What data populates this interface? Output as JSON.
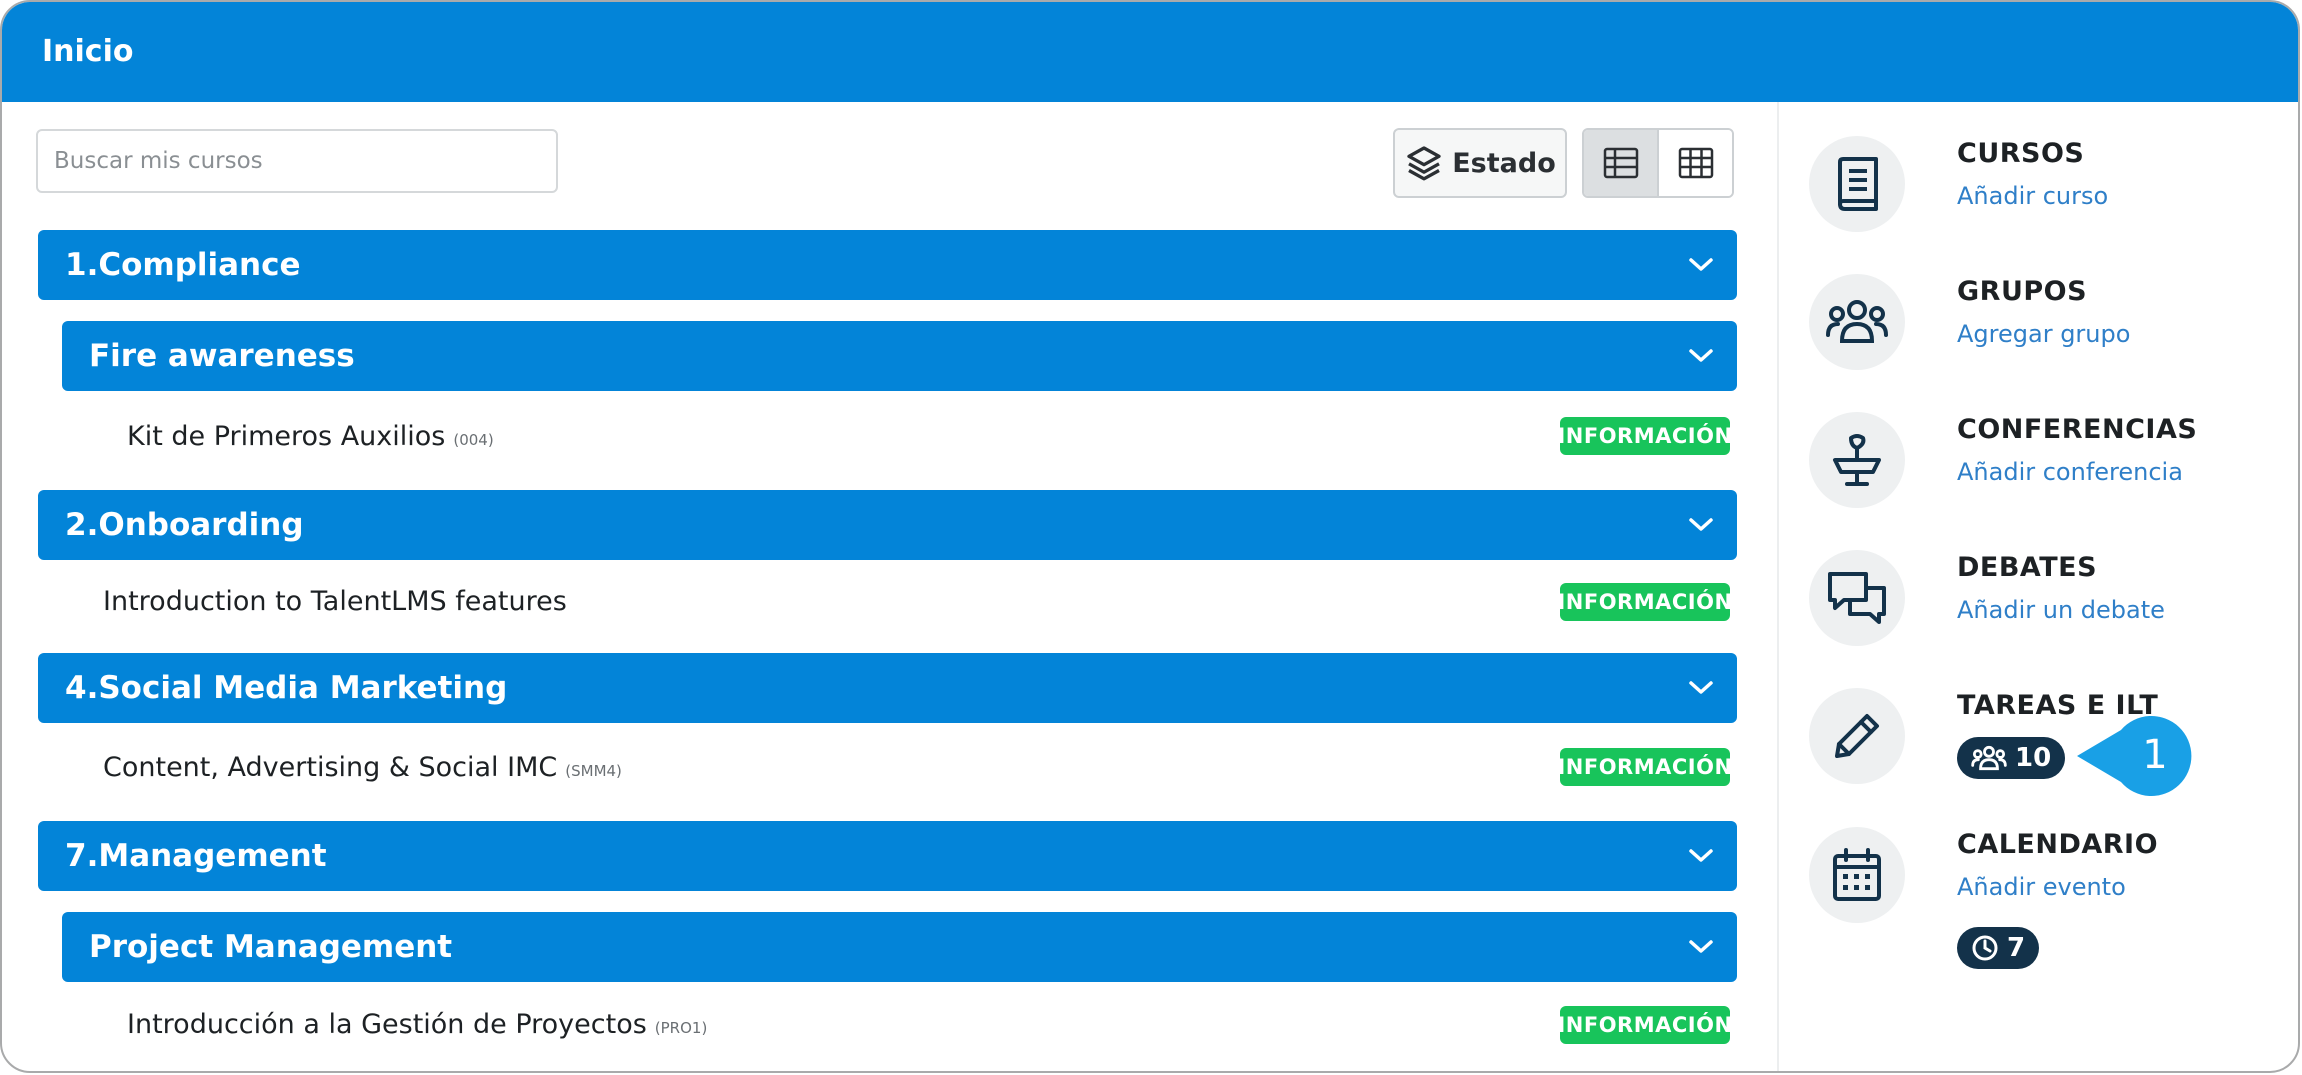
{
  "page": {
    "title": "Inicio"
  },
  "search": {
    "placeholder": "Buscar mis cursos"
  },
  "toolbar": {
    "estado_label": "Estado"
  },
  "categories": [
    {
      "title": "1.Compliance"
    },
    {
      "title": "Fire awareness"
    },
    {
      "title": "2.Onboarding"
    },
    {
      "title": "4.Social Media Marketing"
    },
    {
      "title": "7.Management"
    },
    {
      "title": "Project Management"
    }
  ],
  "courses": [
    {
      "name": "Kit de Primeros Auxilios",
      "code": "(004)",
      "badge": "INFORMACIÓN"
    },
    {
      "name": "Introduction to TalentLMS features",
      "code": "",
      "badge": "INFORMACIÓN"
    },
    {
      "name": "Content, Advertising & Social IMC",
      "code": "(SMM4)",
      "badge": "INFORMACIÓN"
    },
    {
      "name": "Introducción a la Gestión de Proyectos",
      "code": "(PRO1)",
      "badge": "INFORMACIÓN"
    }
  ],
  "sidebar": {
    "items": [
      {
        "label": "CURSOS",
        "link": "Añadir curso",
        "icon": "book-icon"
      },
      {
        "label": "GRUPOS",
        "link": "Agregar grupo",
        "icon": "users-icon"
      },
      {
        "label": "CONFERENCIAS",
        "link": "Añadir conferencia",
        "icon": "conference-icon"
      },
      {
        "label": "DEBATES",
        "link": "Añadir un debate",
        "icon": "discussion-icon"
      },
      {
        "label": "TAREAS E ILT",
        "icon": "pencil-icon",
        "badge_count": "10",
        "badge_icon": "users-icon"
      },
      {
        "label": "CALENDARIO",
        "link": "Añadir evento",
        "icon": "calendar-icon",
        "badge_count": "7",
        "badge_icon": "clock-icon"
      }
    ]
  },
  "callout": {
    "number": "1"
  },
  "colors": {
    "header": "#0384d8",
    "category": "#0384d8",
    "info_badge": "#18c45b",
    "count_badge": "#13324a",
    "link": "#2f7fc8",
    "callout": "#19a0e6"
  }
}
